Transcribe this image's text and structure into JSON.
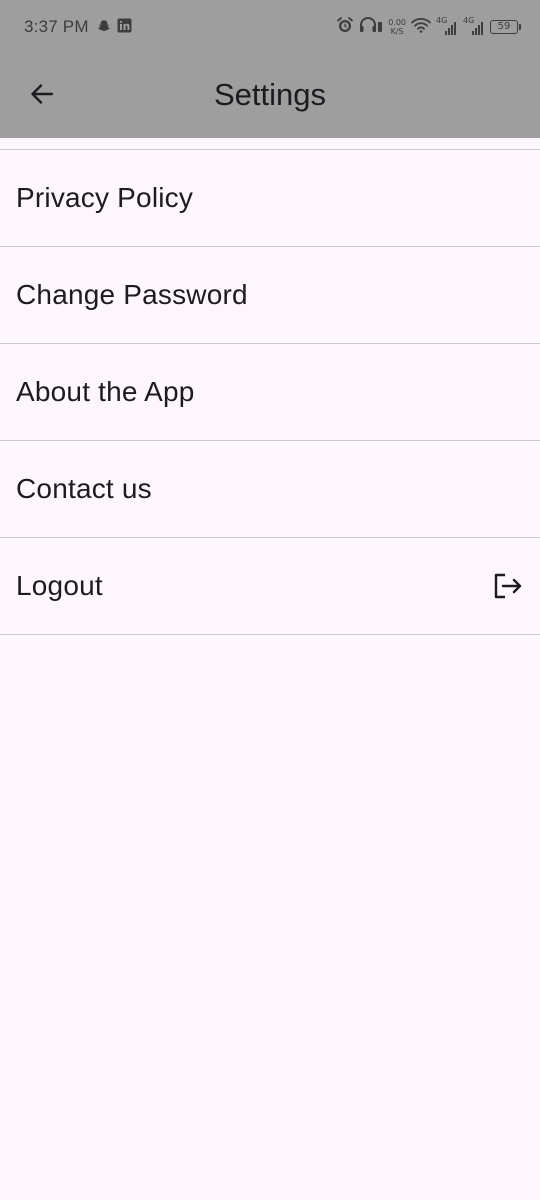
{
  "status_bar": {
    "time": "3:37 PM",
    "left_icons": [
      "snapchat-icon",
      "linkedin-icon"
    ],
    "net_speed_value": "0.00",
    "net_speed_unit": "K/S",
    "sim1_type": "4G",
    "sim2_type": "4G",
    "battery": "59",
    "right_icons": [
      "alarm-icon",
      "headphones-icon",
      "wifi-icon",
      "signal-icon",
      "battery-icon"
    ]
  },
  "app_bar": {
    "title": "Settings",
    "back_icon": "arrow-back-icon",
    "background": "#9e9e9e"
  },
  "settings": {
    "items": [
      {
        "label": "Privacy Policy"
      },
      {
        "label": "Change Password"
      },
      {
        "label": "About the App"
      },
      {
        "label": "Contact us"
      },
      {
        "label": "Logout",
        "trailing_icon": "logout-icon"
      }
    ]
  },
  "colors": {
    "page_background": "#fdf7fd",
    "divider": "#cfcacf",
    "text": "#1d1b20"
  }
}
